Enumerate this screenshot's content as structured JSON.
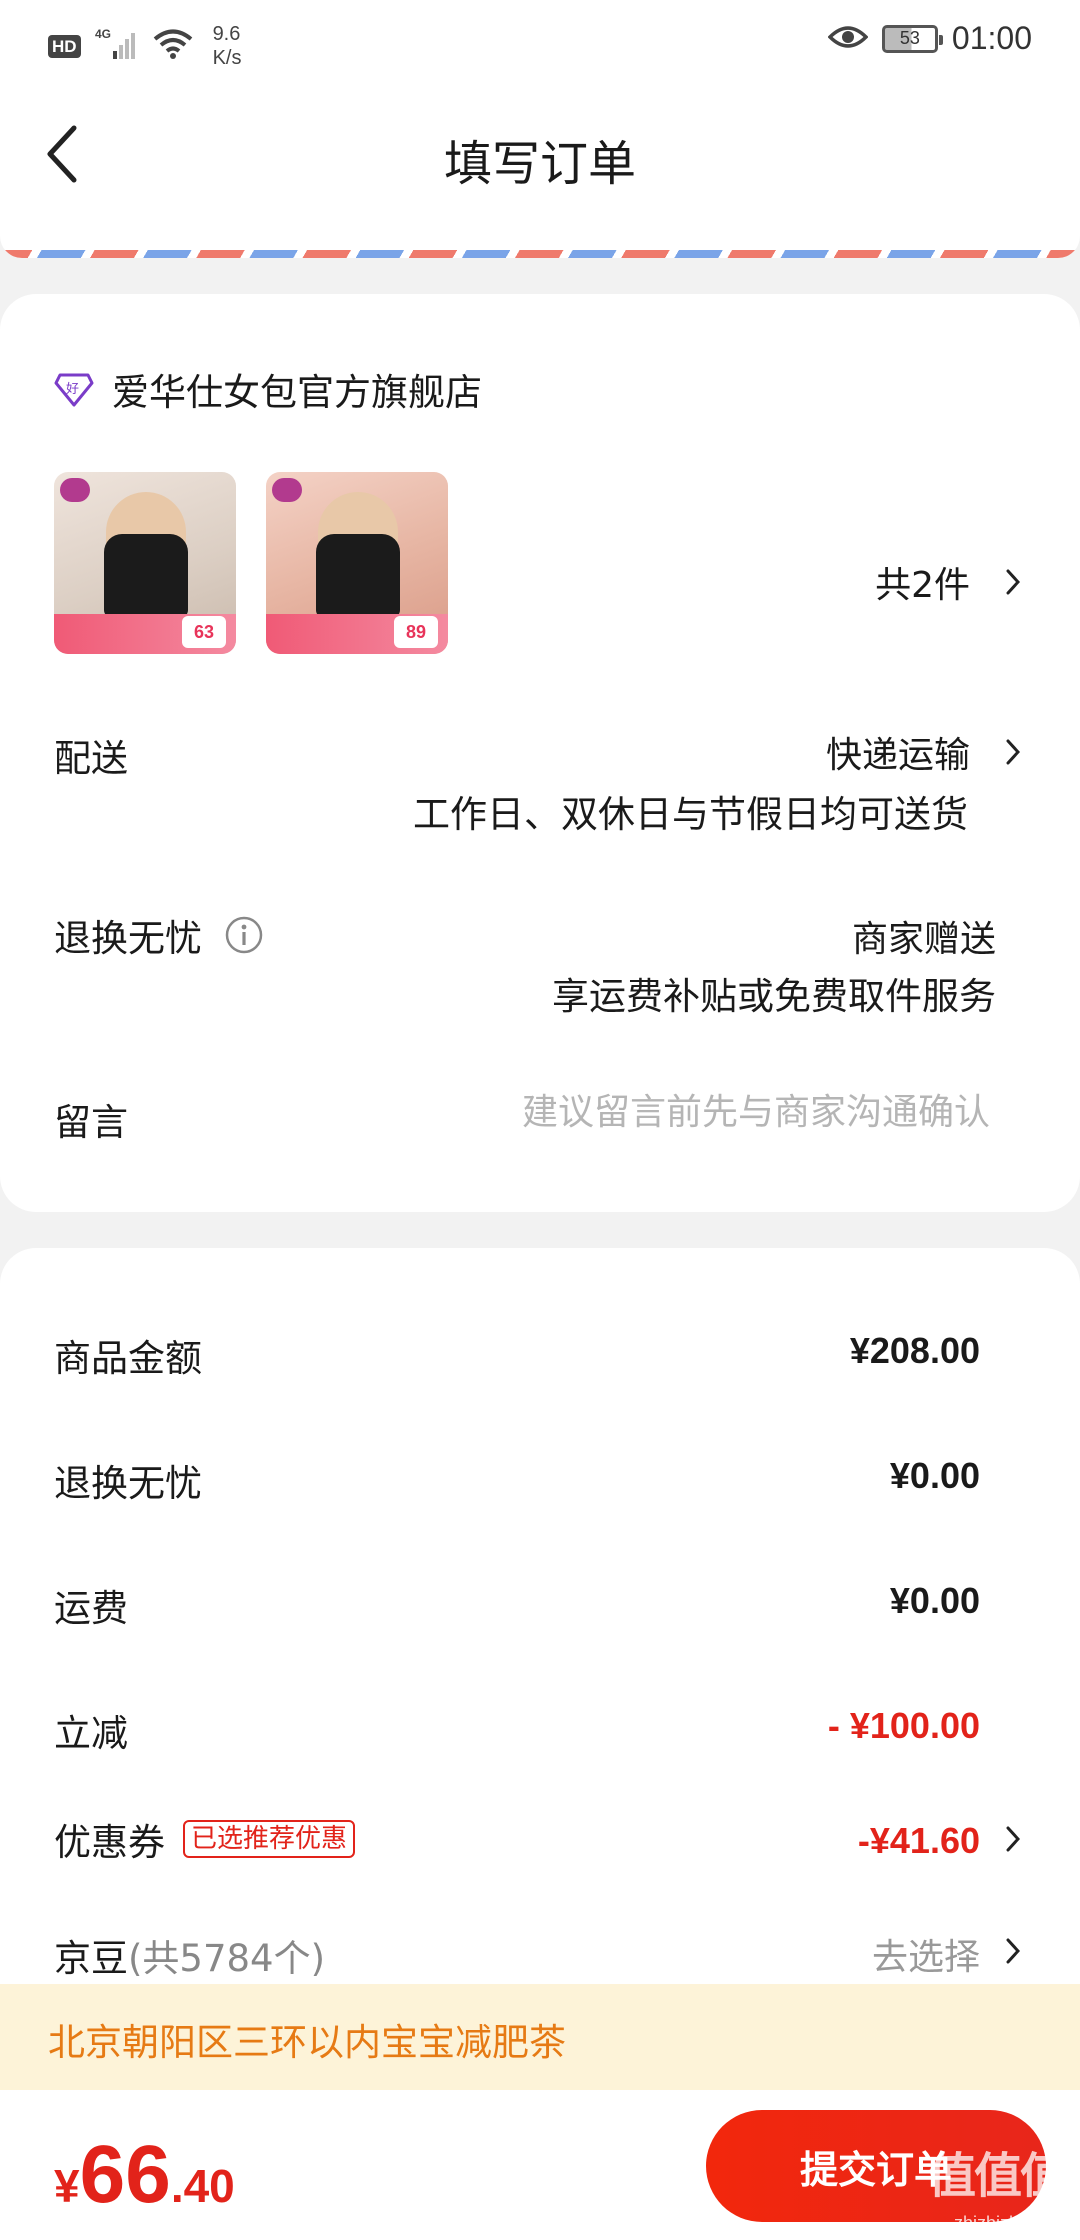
{
  "status_bar": {
    "hd": "HD",
    "network": "4G",
    "speed_value": "9.6",
    "speed_unit": "K/s",
    "battery": "53",
    "time": "01:00"
  },
  "header": {
    "title": "填写订单"
  },
  "shop": {
    "name": "爱华仕女包官方旗舰店",
    "item_count": "共2件",
    "thumb_prices": [
      "63",
      "89"
    ]
  },
  "delivery": {
    "label": "配送",
    "method": "快递运输",
    "note": "工作日、双休日与节假日均可送货"
  },
  "return_service": {
    "label": "退换无忧",
    "value": "商家赠送",
    "note": "享运费补贴或免费取件服务"
  },
  "message": {
    "label": "留言",
    "placeholder": "建议留言前先与商家沟通确认"
  },
  "price_summary": {
    "goods_label": "商品金额",
    "goods_value": "¥208.00",
    "return_label": "退换无忧",
    "return_value": "¥0.00",
    "shipping_label": "运费",
    "shipping_value": "¥0.00",
    "discount_label": "立减",
    "discount_value": "- ¥100.00",
    "coupon_label": "优惠券",
    "coupon_tag": "已选推荐优惠",
    "coupon_value": "-¥41.60",
    "jingdou_label": "京豆",
    "jingdou_count": "(共5784个)",
    "jingdou_action": "去选择"
  },
  "banner": {
    "text": "北京朝阳区三环以内宝宝减肥茶"
  },
  "bottom_bar": {
    "currency": "¥",
    "total_int": "66",
    "total_dec": ".40",
    "submit_label": "提交订单",
    "watermark": "值值值",
    "watermark_url": "zhizhizhi.com"
  },
  "colors": {
    "accent_red": "#e2231a",
    "banner_bg": "#fdf3d8",
    "banner_text": "#e67a14"
  }
}
